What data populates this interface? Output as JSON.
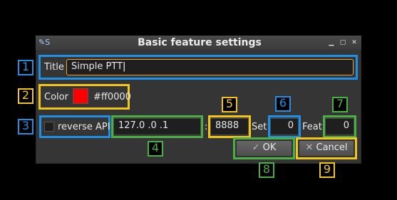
{
  "window": {
    "title": "Basic feature settings",
    "app_icon_text": "✎S",
    "controls": {
      "minimize": "▁",
      "maximize": "▢",
      "close": "✕"
    }
  },
  "title_row": {
    "label": "Title",
    "value": "Simple PTT"
  },
  "color_row": {
    "label": "Color",
    "swatch": "#ff0000",
    "value": "#ff0000"
  },
  "api_row": {
    "checkbox_label": "reverse API",
    "checked": false,
    "address": "127.0  .0  .1",
    "separator": ":",
    "port": "8888",
    "set_label": "Set",
    "set_value": "0",
    "feat_label": "Feat",
    "feat_value": "0"
  },
  "buttons": {
    "ok": "OK",
    "cancel": "Cancel"
  },
  "markers": [
    "1",
    "2",
    "3",
    "4",
    "5",
    "6",
    "7",
    "8",
    "9"
  ],
  "colors": {
    "blue": "#1e90e6",
    "yellow": "#f2c51b",
    "green": "#4bb043",
    "accent": "#f0a030"
  }
}
